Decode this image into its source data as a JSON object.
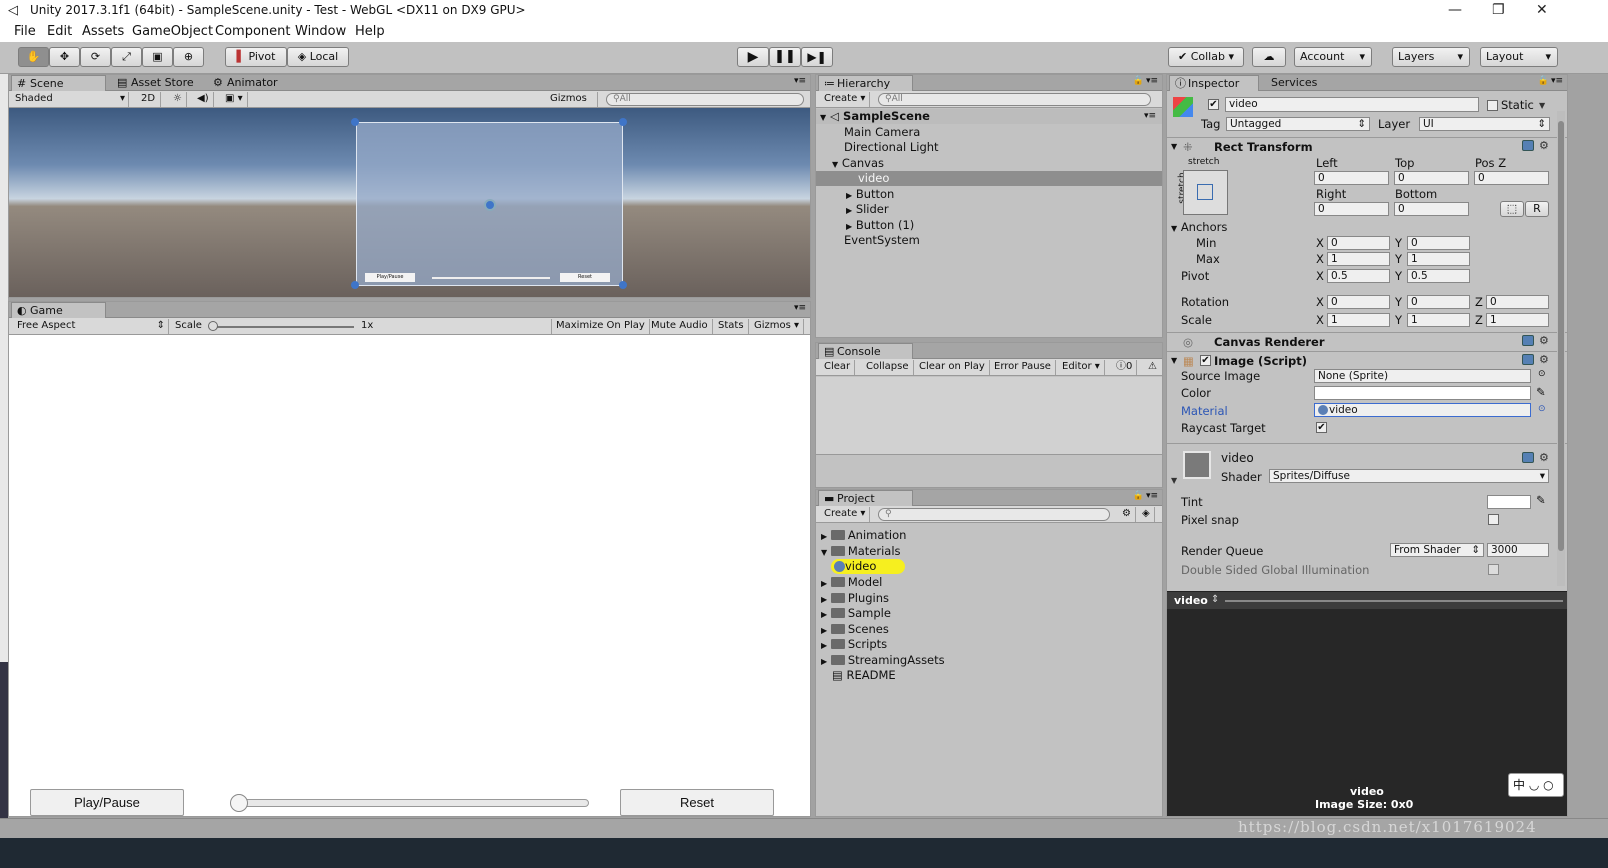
{
  "window": {
    "title": "Unity 2017.3.1f1 (64bit) - SampleScene.unity - Test - WebGL <DX11 on DX9 GPU>"
  },
  "menu": [
    "File",
    "Edit",
    "Assets",
    "GameObject",
    "Component",
    "Window",
    "Help"
  ],
  "toolbar": {
    "pivot": "Pivot",
    "local": "Local",
    "collab": "Collab",
    "account": "Account",
    "layers": "Layers",
    "layout": "Layout"
  },
  "scene": {
    "tabs": [
      "Scene",
      "Asset Store",
      "Animator"
    ],
    "shading": "Shaded",
    "mode2d": "2D",
    "gizmos": "Gizmos",
    "search": "All",
    "button_left": "Play/Pause",
    "button_right": "Reset"
  },
  "game": {
    "tab": "Game",
    "aspect": "Free Aspect",
    "scale_label": "Scale",
    "scale_value": "1x",
    "opts": [
      "Maximize On Play",
      "Mute Audio",
      "Stats",
      "Gizmos"
    ],
    "play_button": "Play/Pause",
    "reset_button": "Reset"
  },
  "hierarchy": {
    "tab": "Hierarchy",
    "create": "Create",
    "search": "All",
    "scene": "SampleScene",
    "items": [
      "Main Camera",
      "Directional Light",
      "Canvas",
      "video",
      "Button",
      "Slider",
      "Button (1)",
      "EventSystem"
    ]
  },
  "console": {
    "tab": "Console",
    "buttons": [
      "Clear",
      "Collapse",
      "Clear on Play",
      "Error Pause",
      "Editor"
    ],
    "count": "0"
  },
  "project": {
    "tab": "Project",
    "create": "Create",
    "items": [
      "Animation",
      "Materials",
      "video",
      "Model",
      "Plugins",
      "Sample",
      "Scenes",
      "Scripts",
      "StreamingAssets",
      "README"
    ]
  },
  "inspector": {
    "tab": "Inspector",
    "tab2": "Services",
    "name": "video",
    "static": "Static",
    "tag_label": "Tag",
    "tag": "Untagged",
    "layer_label": "Layer",
    "layer": "UI",
    "rect": {
      "title": "Rect Transform",
      "stretch": "stretch",
      "stretch_v": "stretch",
      "left": "Left",
      "top": "Top",
      "posz": "Pos Z",
      "left_v": "0",
      "top_v": "0",
      "posz_v": "0",
      "right": "Right",
      "bottom": "Bottom",
      "right_v": "0",
      "bottom_v": "0",
      "r": "R",
      "anchors": "Anchors",
      "min": "Min",
      "max": "Max",
      "min_x": "0",
      "min_y": "0",
      "max_x": "1",
      "max_y": "1",
      "pivot": "Pivot",
      "pivot_x": "0.5",
      "pivot_y": "0.5",
      "rotation": "Rotation",
      "rot_x": "0",
      "rot_y": "0",
      "rot_z": "0",
      "scale": "Scale",
      "sc_x": "1",
      "sc_y": "1",
      "sc_z": "1",
      "x": "X",
      "y": "Y",
      "z": "Z"
    },
    "canvas_renderer": "Canvas Renderer",
    "image": {
      "title": "Image (Script)",
      "source_label": "Source Image",
      "source": "None (Sprite)",
      "color_label": "Color",
      "material_label": "Material",
      "material": "video",
      "raycast_label": "Raycast Target"
    },
    "material": {
      "name": "video",
      "shader_label": "Shader",
      "shader": "Sprites/Diffuse",
      "tint": "Tint",
      "pixel_snap": "Pixel snap",
      "render_queue": "Render Queue",
      "rq_mode": "From Shader",
      "rq_value": "3000",
      "dsgi": "Double Sided Global Illumination"
    },
    "preview": {
      "title": "video",
      "caption": "video",
      "size": "Image Size: 0x0"
    }
  },
  "watermark": "https://blog.csdn.net/x1017619024",
  "ime": "中"
}
